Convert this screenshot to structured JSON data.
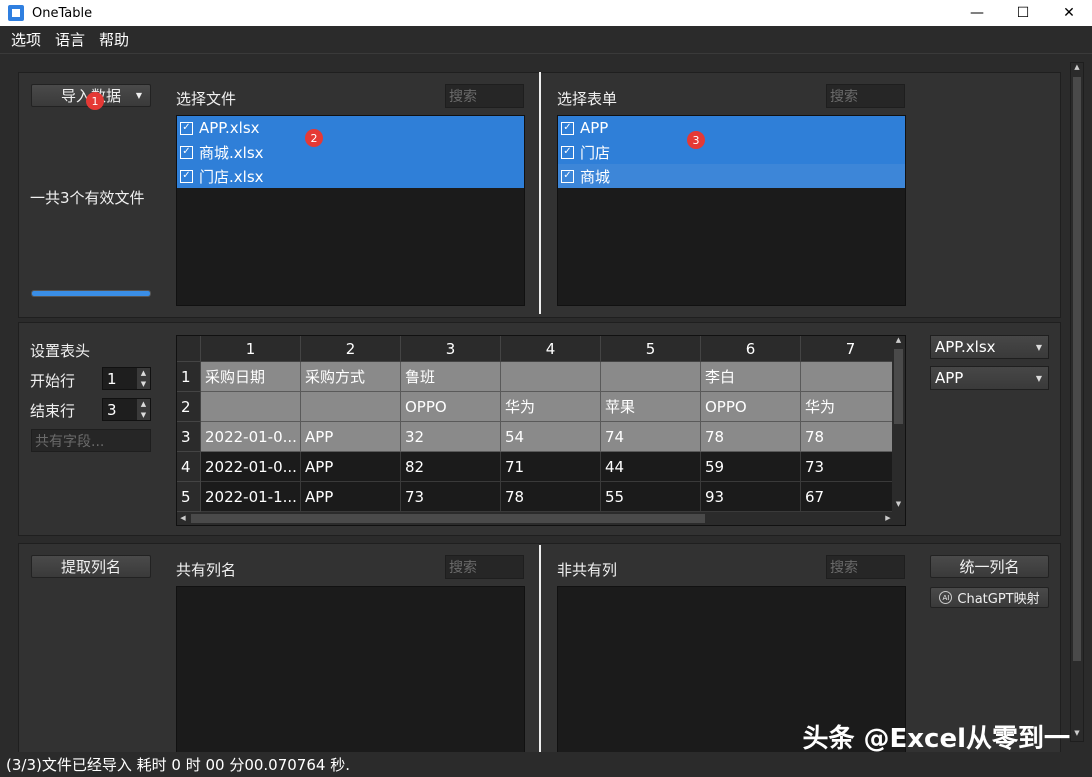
{
  "window": {
    "title": "OneTable",
    "minimize": "—",
    "maximize": "☐",
    "close": "✕"
  },
  "menu": [
    "选项",
    "语言",
    "帮助"
  ],
  "import": {
    "button_label": "导入数据",
    "file_count_text": "一共3个有效文件",
    "progress": 1.0
  },
  "files": {
    "label": "选择文件",
    "search_placeholder": "搜索",
    "items": [
      "APP.xlsx",
      "商城.xlsx",
      "门店.xlsx"
    ]
  },
  "sheets": {
    "label": "选择表单",
    "search_placeholder": "搜索",
    "items": [
      "APP",
      "门店",
      "商城"
    ]
  },
  "badges": [
    "1",
    "2",
    "3"
  ],
  "header_settings": {
    "title": "设置表头",
    "start_row_label": "开始行",
    "start_row_value": "1",
    "end_row_label": "结束行",
    "end_row_value": "3",
    "field_placeholder": "共有字段..."
  },
  "table": {
    "columns": [
      "1",
      "2",
      "3",
      "4",
      "5",
      "6",
      "7"
    ],
    "row_headers": [
      "1",
      "2",
      "3",
      "4",
      "5"
    ],
    "rows": [
      [
        "采购日期",
        "采购方式",
        "鲁班",
        "",
        "",
        "李白",
        ""
      ],
      [
        "",
        "",
        "OPPO",
        "华为",
        "苹果",
        "OPPO",
        "华为"
      ],
      [
        "2022-01-0...",
        "APP",
        "32",
        "54",
        "74",
        "78",
        "78"
      ],
      [
        "2022-01-0...",
        "APP",
        "82",
        "71",
        "44",
        "59",
        "73"
      ],
      [
        "2022-01-1...",
        "APP",
        "73",
        "78",
        "55",
        "93",
        "67"
      ]
    ]
  },
  "selectors": {
    "file_value": "APP.xlsx",
    "sheet_value": "APP"
  },
  "columns_section": {
    "extract_button": "提取列名",
    "common_label": "共有列名",
    "common_search_placeholder": "搜索",
    "noncommon_label": "非共有列",
    "noncommon_search_placeholder": "搜索",
    "unify_button": "统一列名",
    "chatgpt_button": "ChatGPT映射"
  },
  "status": {
    "text": "(3/3)文件已经导入 耗时 0 时 00 分00.070764 秒."
  },
  "watermark": "头条 @Excel从零到一"
}
